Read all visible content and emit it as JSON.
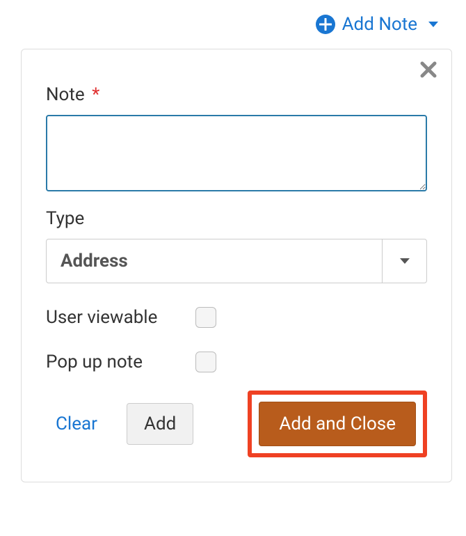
{
  "trigger": {
    "label": "Add Note"
  },
  "modal": {
    "note": {
      "label": "Note",
      "required_marker": "*",
      "value": ""
    },
    "type": {
      "label": "Type",
      "selected": "Address"
    },
    "user_viewable": {
      "label": "User viewable",
      "checked": false
    },
    "pop_up_note": {
      "label": "Pop up note",
      "checked": false
    },
    "actions": {
      "clear": "Clear",
      "add": "Add",
      "add_and_close": "Add and Close"
    }
  }
}
